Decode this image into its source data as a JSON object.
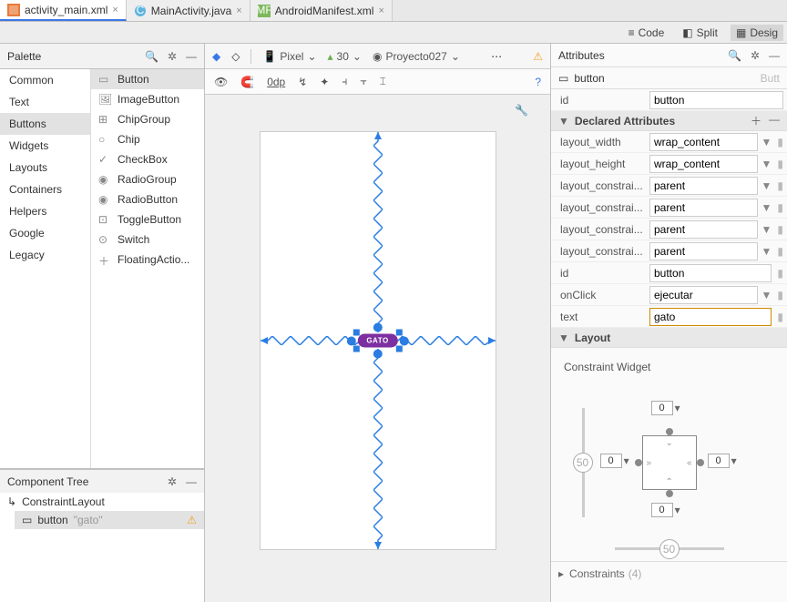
{
  "tabs": [
    {
      "label": "activity_main.xml",
      "active": true
    },
    {
      "label": "MainActivity.java",
      "active": false
    },
    {
      "label": "AndroidManifest.xml",
      "active": false
    }
  ],
  "viewmodes": {
    "code": "Code",
    "split": "Split",
    "design": "Desig"
  },
  "palette": {
    "title": "Palette",
    "categories": [
      "Common",
      "Text",
      "Buttons",
      "Widgets",
      "Layouts",
      "Containers",
      "Helpers",
      "Google",
      "Legacy"
    ],
    "selected_cat": "Buttons",
    "widgets": [
      "Button",
      "ImageButton",
      "ChipGroup",
      "Chip",
      "CheckBox",
      "RadioGroup",
      "RadioButton",
      "ToggleButton",
      "Switch",
      "FloatingActio..."
    ],
    "selected_widget": "Button"
  },
  "toprow": {
    "device": "Pixel",
    "api": "30",
    "theme": "Proyecto027"
  },
  "toolrow": {
    "dp": "0dp"
  },
  "tree": {
    "title": "Component Tree",
    "root": "ConstraintLayout",
    "child": "button",
    "child_text": "\"gato\""
  },
  "designer": {
    "button_text": "GATO"
  },
  "attributes": {
    "title": "Attributes",
    "type": "button",
    "type_hint": "Butt",
    "id_label": "id",
    "id_value": "button",
    "declared_title": "Declared Attributes",
    "rows": [
      {
        "label": "layout_width",
        "value": "wrap_content",
        "dd": true
      },
      {
        "label": "layout_height",
        "value": "wrap_content",
        "dd": true
      },
      {
        "label": "layout_constrai...",
        "value": "parent",
        "dd": true
      },
      {
        "label": "layout_constrai...",
        "value": "parent",
        "dd": true
      },
      {
        "label": "layout_constrai...",
        "value": "parent",
        "dd": true
      },
      {
        "label": "layout_constrai...",
        "value": "parent",
        "dd": true
      },
      {
        "label": "id",
        "value": "button",
        "dd": false
      },
      {
        "label": "onClick",
        "value": "ejecutar",
        "dd": true
      },
      {
        "label": "text",
        "value": "gato",
        "dd": false,
        "hl": true
      }
    ],
    "layout_title": "Layout",
    "cw_label": "Constraint Widget",
    "margins": {
      "top": "0",
      "bottom": "0",
      "left": "0",
      "right": "0"
    },
    "bias": {
      "h": "50",
      "v": "50"
    },
    "constraints_label": "Constraints",
    "constraints_count": "(4)"
  }
}
